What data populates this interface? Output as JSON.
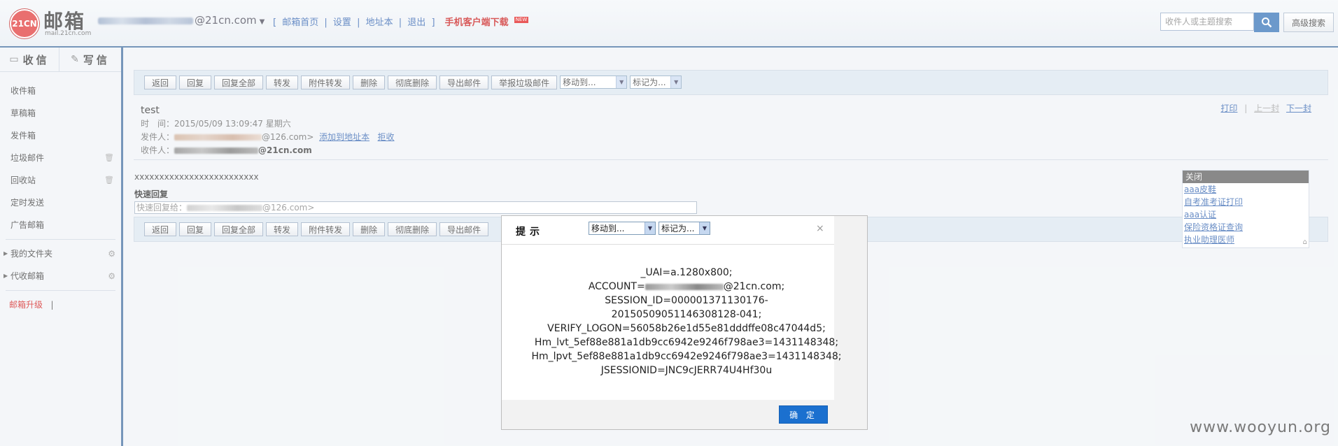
{
  "header": {
    "logo_mark": "21CN",
    "logo_title": "邮箱",
    "logo_sub": "mail.21cn.com",
    "account_suffix": "@21cn.com",
    "nav": [
      "[",
      "邮箱首页",
      "|",
      "设置",
      "|",
      "地址本",
      "|",
      "退出",
      "]"
    ],
    "mobile_download": "手机客户端下载",
    "new_badge": "NEW",
    "search_placeholder": "收件人或主题搜索",
    "advanced_search": "高级搜索"
  },
  "sidebar": {
    "inbox_btn": "收信",
    "write_btn": "写信",
    "folders": [
      "收件箱",
      "草稿箱",
      "发件箱",
      "垃圾邮件",
      "回收站",
      "定时发送",
      "广告邮箱"
    ],
    "my_folders": "我的文件夹",
    "agent_mail": "代收邮箱",
    "upgrade": "邮箱升级",
    "upgrade_sep": "|"
  },
  "toolbar": {
    "buttons": [
      "返回",
      "回复",
      "回复全部",
      "转发",
      "附件转发",
      "删除",
      "彻底删除",
      "导出邮件",
      "举报垃圾邮件"
    ],
    "move_to": "移动到...",
    "mark_as": "标记为..."
  },
  "message": {
    "subject": "test",
    "time_label": "时　间：",
    "time_value": "2015/05/09 13:09:47 星期六",
    "from_label": "发件人：",
    "from_suffix": "@126.com>",
    "add_to_contacts": "添加到地址本",
    "reject": "拒收",
    "to_label": "收件人：",
    "to_suffix": "@21cn.com",
    "print": "打印",
    "sep": "|",
    "prev": "上一封",
    "next": "下一封",
    "body": "xxxxxxxxxxxxxxxxxxxxxxxxx",
    "quick_reply": "快速回复",
    "quick_reply_prefix": "快速回复给：",
    "quick_reply_suffix": "@126.com>"
  },
  "ads": {
    "close": "关闭",
    "links": [
      "aaa皮鞋",
      "自考准考证打印",
      "aaa认证",
      "保险资格证查询",
      "执业助理医师"
    ]
  },
  "dialog": {
    "title": "提示",
    "close": "×",
    "lines": [
      "_UAI=a.1280x800;",
      "ACCOUNT=",
      "@21cn.com;",
      "SESSION_ID=000001371130176-",
      "2015050905114630812​8-041;",
      "VERIFY_LOGON=56058b26e1d55e81dddffe08c47044d5;",
      "Hm_lvt_5ef88e881a1db9cc6942e9246f798ae3=1431148348;",
      "Hm_lpvt_5ef88e881a1db9cc6942e9246f798ae3=1431148348;",
      "JSESSIONID=JNC9cJERR74U4Hf30u"
    ],
    "ok": "确 定"
  },
  "watermark": "www.wooyun.org"
}
